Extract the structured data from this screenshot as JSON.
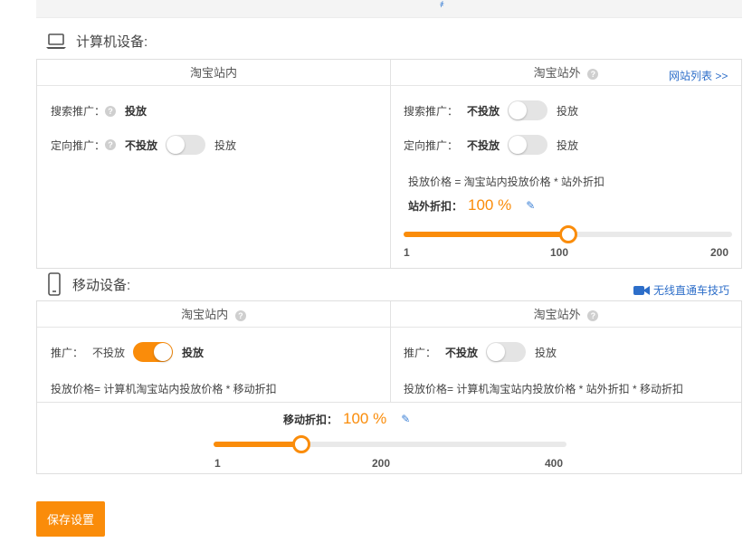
{
  "top": {
    "mark": "҂"
  },
  "computer": {
    "title": "计算机设备:",
    "inside": {
      "title": "淘宝站内",
      "search_label": "搜索推广：",
      "search_value": "投放",
      "target_label": "定向推广：",
      "target_off": "不投放",
      "target_on": "投放",
      "target_enabled": false
    },
    "outside": {
      "title": "淘宝站外",
      "site_list_link": "网站列表 >>",
      "search_label": "搜索推广：",
      "search_off": "不投放",
      "search_on": "投放",
      "search_enabled": false,
      "target_label": "定向推广：",
      "target_off": "不投放",
      "target_on": "投放",
      "target_enabled": false,
      "formula": "投放价格 = 淘宝站内投放价格 * 站外折扣",
      "discount_label": "站外折扣：",
      "discount_value": "100 %",
      "slider": {
        "min": "1",
        "mid": "100",
        "max": "200",
        "value": 100,
        "min_value": 1,
        "max_value": 200
      }
    }
  },
  "mobile": {
    "title": "移动设备:",
    "tips_link": "无线直通车技巧",
    "inside": {
      "title": "淘宝站内",
      "promo_label": "推广：",
      "off": "不投放",
      "on": "投放",
      "enabled": true,
      "formula": "投放价格= 计算机淘宝站内投放价格 * 移动折扣"
    },
    "outside": {
      "title": "淘宝站外",
      "promo_label": "推广：",
      "off": "不投放",
      "on": "投放",
      "enabled": false,
      "formula": "投放价格= 计算机淘宝站内投放价格 * 站外折扣 * 移动折扣"
    },
    "discount_label": "移动折扣：",
    "discount_value": "100 %",
    "slider": {
      "min": "1",
      "mid": "200",
      "max": "400",
      "value": 100,
      "min_value": 1,
      "max_value": 400
    }
  },
  "save_button": "保存设置",
  "colors": {
    "accent": "#fa8c0a",
    "link": "#2d6ec9"
  },
  "icons": {
    "help": "question-icon",
    "edit": "pencil-icon",
    "computer": "laptop-icon",
    "mobile": "phone-icon",
    "video": "video-camera-icon"
  }
}
